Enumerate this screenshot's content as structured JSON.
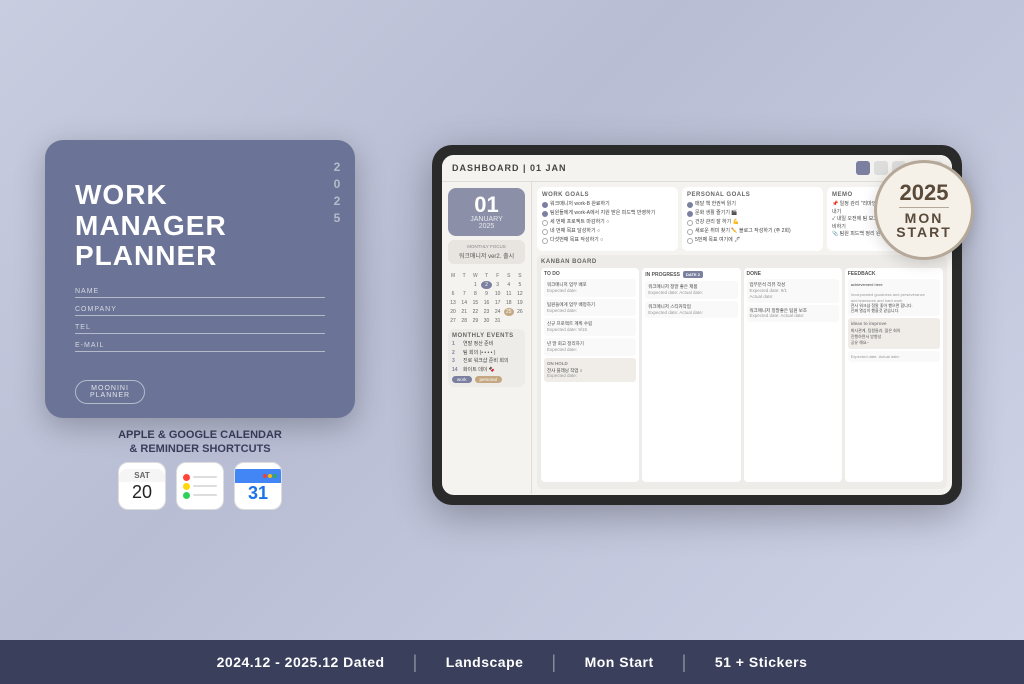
{
  "left_tablet": {
    "title_line1": "WORK",
    "title_line2": "MANAGER",
    "title_line3": "PLANNER",
    "fields": [
      {
        "label": "NAME"
      },
      {
        "label": "COMPANY"
      },
      {
        "label": "TEL"
      },
      {
        "label": "E-MAIL"
      }
    ],
    "logo_text": "MOONINI\nPLANNER",
    "year": "2025"
  },
  "shortcuts_label": "APPLE & GOOGLE CALENDAR\n& REMINDER SHORTCUTS",
  "calendar_icon": {
    "day": "SAT",
    "num": "20"
  },
  "gcal_icon": {
    "num": "31"
  },
  "dashboard": {
    "header": "DASHBOARD | 01 JAN",
    "date_num": "01",
    "date_month": "JANUARY",
    "date_year": "2025",
    "monthly_focus_label": "MONTHLY FOCUS",
    "monthly_focus_text": "워크매니저 ver2. 출시",
    "work_goals_title": "WORK GOALS",
    "personal_goals_title": "PERSONAL GOALS",
    "memo_title": "MEMO",
    "kanban_title": "KANBAN BOARD",
    "monthly_events_title": "MONTHLY EVENTS",
    "kanban_columns": [
      {
        "title": "TO DO"
      },
      {
        "title": "IN PROGRESS"
      },
      {
        "title": "DONE"
      },
      {
        "title": "FEEDBACK"
      }
    ]
  },
  "mon_start_badge": {
    "year": "2025",
    "line1": "MON",
    "line2": "START"
  },
  "bottom_bar": {
    "item1": "2024.12 - 2025.12 Dated",
    "item2": "Landscape",
    "item3": "Mon Start",
    "item4": "51 + Stickers"
  }
}
